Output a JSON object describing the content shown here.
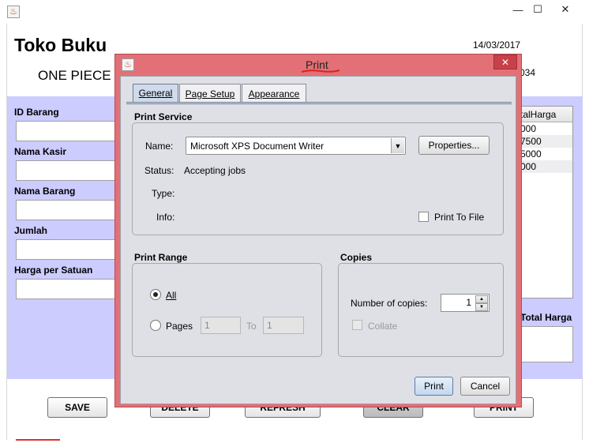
{
  "main_window": {
    "title_icon": "java-icon",
    "controls": {
      "minimize": "—",
      "maximize": "☐",
      "close": "✕"
    },
    "store_title": "Toko Buku",
    "store_subtitle": "ONE PIECE",
    "date": "14/03/2017",
    "partial_number": "034",
    "form": {
      "id_barang_label": "ID Barang",
      "nama_kasir_label": "Nama Kasir",
      "nama_barang_label": "Nama Barang",
      "jumlah_label": "Jumlah",
      "harga_label": "Harga per Satuan"
    },
    "table": {
      "header": "talHarga",
      "rows": [
        "000",
        "7500",
        "5000",
        "000"
      ]
    },
    "total_label": "Total Harga",
    "buttons": {
      "save": "SAVE",
      "delete": "DELETE",
      "refresh": "REFRESH",
      "clear": "CLEAR",
      "print": "PRINT"
    }
  },
  "print_dialog": {
    "title": "Print",
    "close": "✕",
    "tabs": [
      "General",
      "Page Setup",
      "Appearance"
    ],
    "service": {
      "group_title": "Print Service",
      "name_label": "Name:",
      "printer": "Microsoft XPS Document Writer",
      "properties_button": "Properties...",
      "status_label": "Status:",
      "status_value": "Accepting jobs",
      "type_label": "Type:",
      "info_label": "Info:",
      "print_to_file": "Print To File"
    },
    "range": {
      "group_title": "Print Range",
      "all": "All",
      "pages": "Pages",
      "from": "1",
      "to_label": "To",
      "to": "1"
    },
    "copies": {
      "group_title": "Copies",
      "number_label": "Number of copies:",
      "value": "1",
      "collate": "Collate"
    },
    "print_button": "Print",
    "cancel_button": "Cancel"
  }
}
